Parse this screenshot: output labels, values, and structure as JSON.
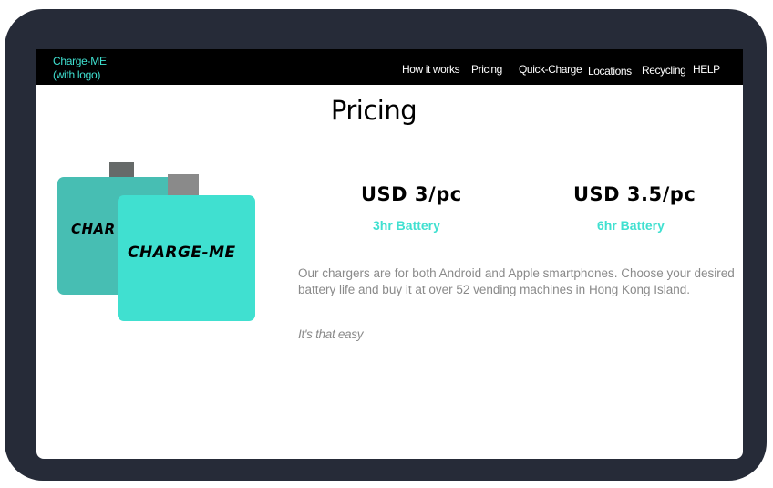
{
  "header": {
    "brand_line1": "Charge-ME",
    "brand_line2": "(with logo)",
    "nav": [
      {
        "label": "How it works"
      },
      {
        "label": "Pricing"
      },
      {
        "label": "Quick-Charge"
      },
      {
        "label": "Locations"
      },
      {
        "label": "Recycling"
      },
      {
        "label": "HELP"
      }
    ]
  },
  "main": {
    "title": "Pricing",
    "illustration": {
      "back_label": "CHAR",
      "front_label": "CHARGE-ME"
    },
    "plans": [
      {
        "price": "USD 3/pc",
        "battery": "3hr Battery"
      },
      {
        "price": "USD 3.5/pc",
        "battery": "6hr Battery"
      }
    ],
    "description": "Our chargers are for both Android and Apple smartphones. Choose your desired battery life and buy it at over 52 vending machines in Hong Kong Island.",
    "tagline": "It's that easy"
  },
  "colors": {
    "frame": "#262b38",
    "accent": "#40e0d0",
    "accent_dark": "#47beb3",
    "text_muted": "#8a8a8a"
  }
}
